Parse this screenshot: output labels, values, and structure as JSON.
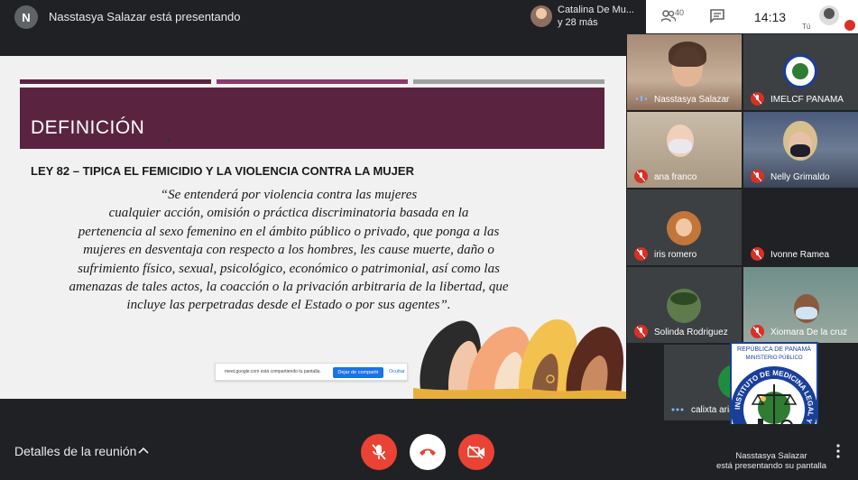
{
  "topbar": {
    "presenter_initial": "N",
    "presenter_text": "Nasstasya Salazar está presentando",
    "participants_name": "Catalina De Mu...",
    "participants_more": "y 28 más",
    "people_count": "40",
    "time": "14:13",
    "self_label": "Tú"
  },
  "slide": {
    "title": "DEFINICIÓN",
    "law_heading": "LEY 82 – TIPICA EL FEMICIDIO Y LA VIOLENCIA CONTRA LA MUJER",
    "quote_lines": [
      "“Se entenderá por violencia contra las mujeres",
      "cualquier acción, omisión o práctica discriminatoria basada en la",
      "pertenencia al sexo femenino en el ámbito público o privado, que ponga a las",
      "mujeres en desventaja con respecto a los hombres, les cause muerte, daño o",
      "sufrimiento físico, sexual, psicológico, económico o patrimonial, así como las",
      "amenazas de tales actos, la coacción o la privación arbitraria de la libertad, que",
      "incluye las perpetradas desde el Estado o por sus agentes”."
    ],
    "stripe_colors": [
      "#5a2440",
      "#8b3a6b",
      "#a0a0a0"
    ],
    "title_band_color": "#5a2440"
  },
  "share_bar": {
    "text": "meet.google.com está compartiendo tu pantalla.",
    "stop_label": "Dejar de compartir",
    "hide_label": "Ocultar"
  },
  "participants": [
    {
      "name": "Nasstasya Salazar",
      "muted": false
    },
    {
      "name": "IMELCF PANAMA",
      "muted": true
    },
    {
      "name": "ana franco",
      "muted": true
    },
    {
      "name": "Nelly Grimaldo",
      "muted": true
    },
    {
      "name": "iris romero",
      "muted": true
    },
    {
      "name": "Ivonne Ramea",
      "muted": true
    },
    {
      "name": "Solinda Rodriguez",
      "muted": true
    },
    {
      "name": "Xiomara De la cruz",
      "muted": true
    },
    {
      "name": "calixta arias",
      "muted": false
    }
  ],
  "logo": {
    "line1": "REPÚBLICA DE PANAMÁ",
    "line2": "MINISTERIO PÚBLICO",
    "ring_text": "INSTITUTO DE MEDICINA LEGAL Y CIENCIAS FORENSES"
  },
  "bottombar": {
    "details_label": "Detalles de la reunión",
    "present_line1": "Nasstasya Salazar",
    "present_line2": "está presentando su pantalla"
  },
  "colors": {
    "end_call": "#ea4335",
    "muted_red": "#d93025",
    "accent_blue": "#1a73e8"
  }
}
